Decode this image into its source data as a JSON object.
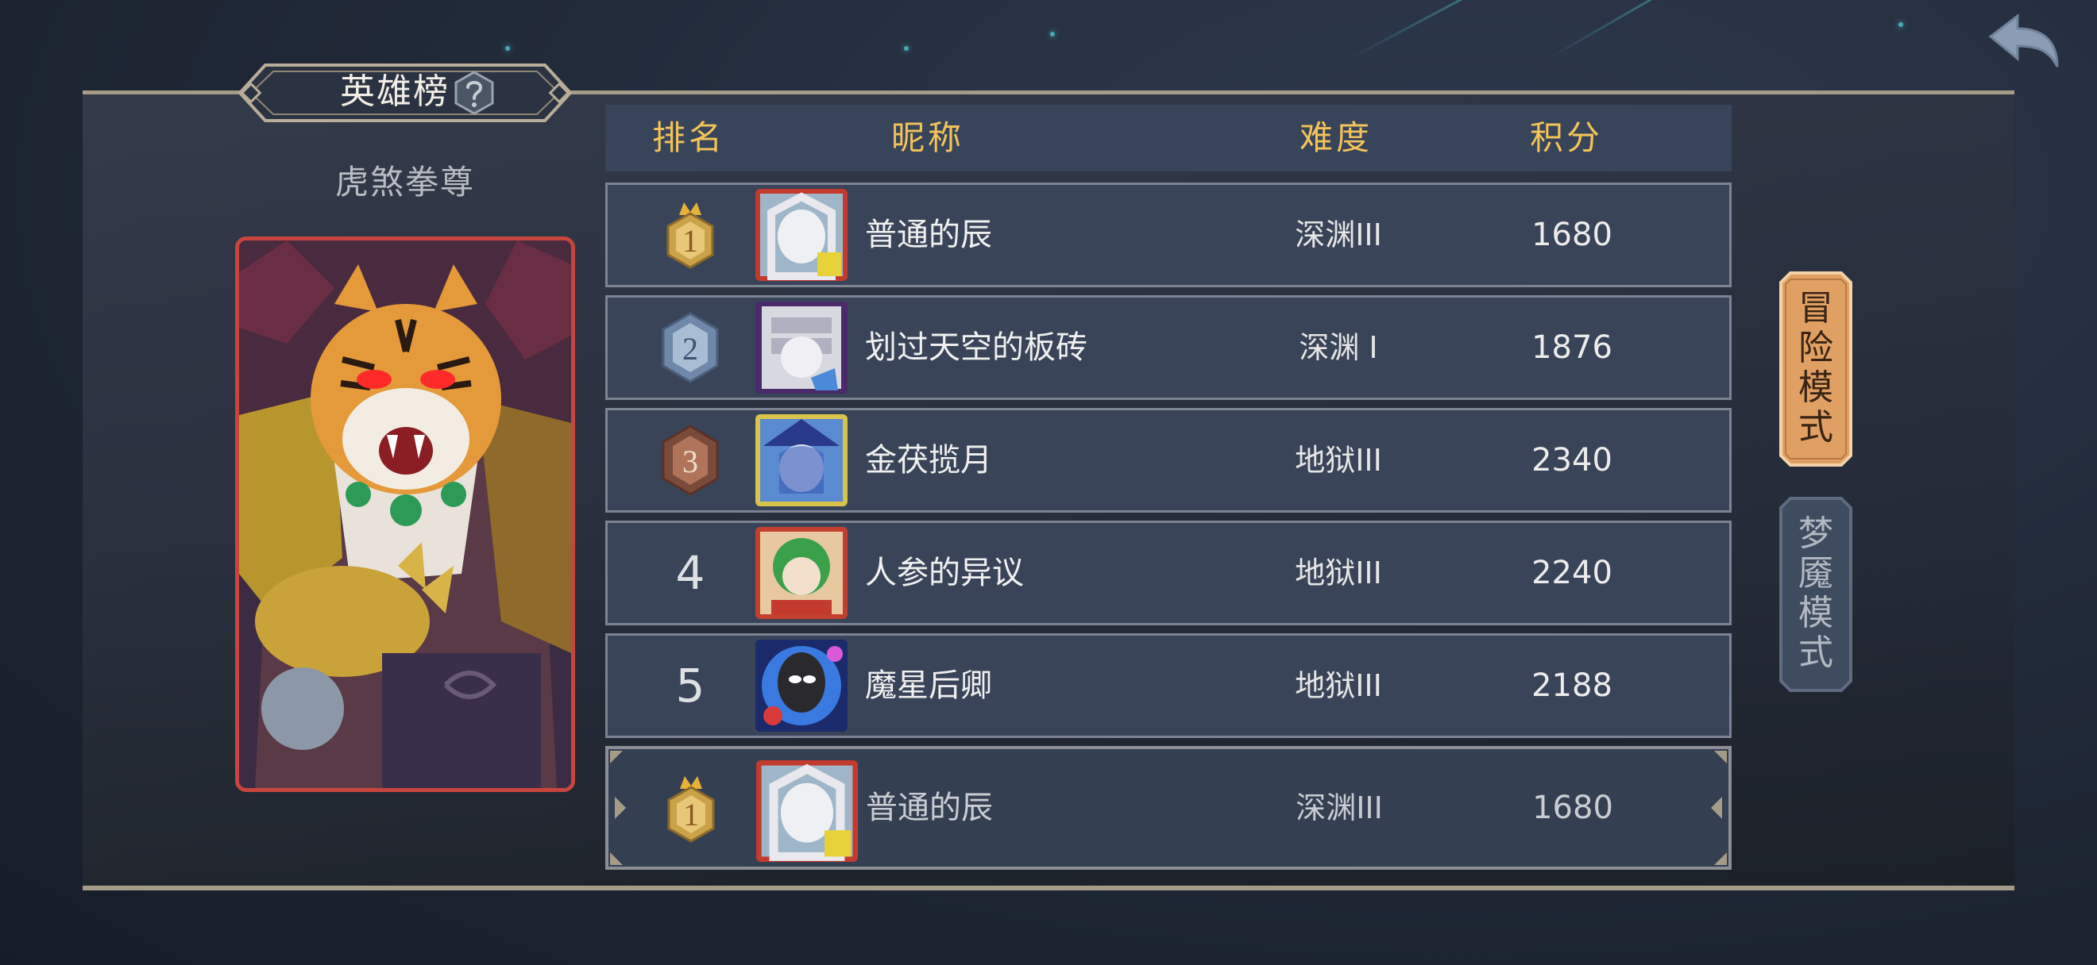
{
  "header": {
    "title": "英雄榜",
    "back_icon": "back-arrow-icon",
    "help_icon": "question-icon"
  },
  "hero": {
    "name": "虎煞拳尊",
    "portrait": "tiger-warrior-portrait"
  },
  "table": {
    "columns": [
      "排名",
      "昵称",
      "难度",
      "积分"
    ],
    "rows": [
      {
        "rank": "1",
        "badge": "gold-crown-badge",
        "nickname": "普通的辰",
        "difficulty": "深渊III",
        "score": "1680"
      },
      {
        "rank": "2",
        "badge": "silver-badge",
        "nickname": "划过天空的板砖",
        "difficulty": "深渊 I",
        "score": "1876"
      },
      {
        "rank": "3",
        "badge": "bronze-badge",
        "nickname": "金茯揽月",
        "difficulty": "地狱III",
        "score": "2340"
      },
      {
        "rank": "4",
        "badge": "",
        "nickname": "人参的异议",
        "difficulty": "地狱III",
        "score": "2240"
      },
      {
        "rank": "5",
        "badge": "",
        "nickname": "魔星后卿",
        "difficulty": "地狱III",
        "score": "2188"
      }
    ],
    "my_row": {
      "rank": "1",
      "badge": "gold-crown-badge",
      "nickname": "普通的辰",
      "difficulty": "深渊III",
      "score": "1680"
    }
  },
  "modes": [
    {
      "label": "冒险模式",
      "active": true
    },
    {
      "label": "梦魇模式",
      "active": false
    }
  ],
  "colors": {
    "header_text": "#f2c35a",
    "active_mode": "#e0a064",
    "inactive_mode": "#3f4b5f",
    "hero_card_border": "#c8453e"
  }
}
